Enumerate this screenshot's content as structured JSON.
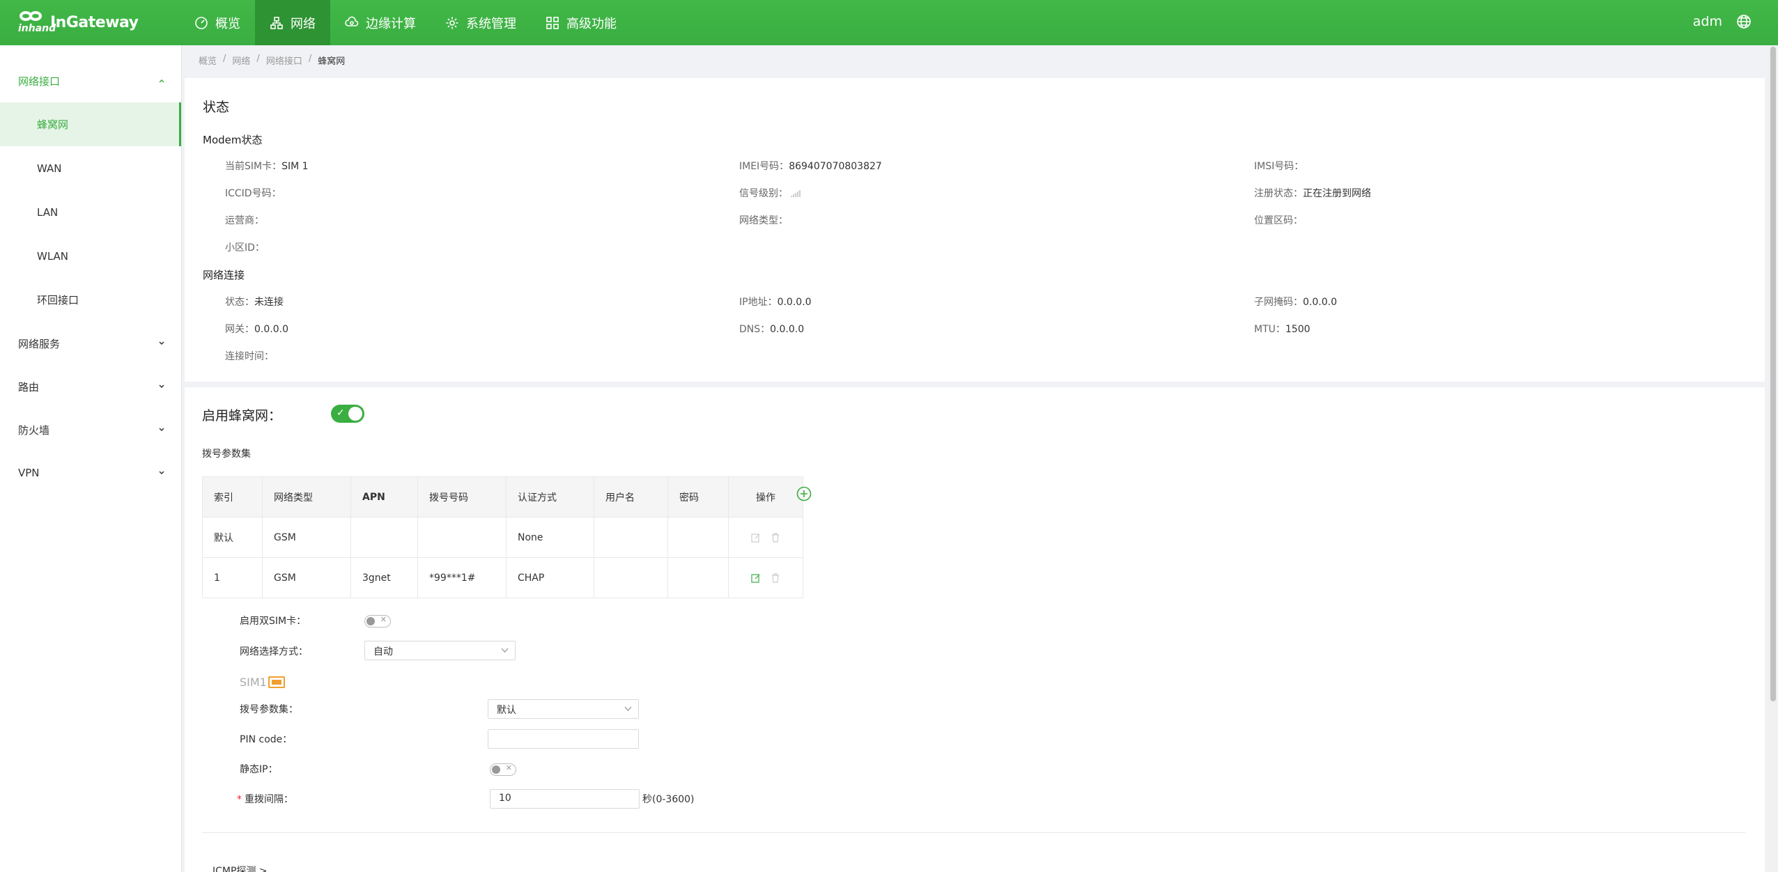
{
  "app": {
    "logo_text": "InGateway",
    "logo_sub": "inhand"
  },
  "topnav": {
    "items": [
      {
        "label": "概览"
      },
      {
        "label": "网络"
      },
      {
        "label": "边缘计算"
      },
      {
        "label": "系统管理"
      },
      {
        "label": "高级功能"
      }
    ],
    "active_index": 1,
    "user": "adm"
  },
  "sidebar": {
    "groups": [
      {
        "label": "网络接口",
        "open": true,
        "items": [
          "蜂窝网",
          "WAN",
          "LAN",
          "WLAN",
          "环回接口"
        ],
        "active": "蜂窝网"
      },
      {
        "label": "网络服务",
        "open": false
      },
      {
        "label": "路由",
        "open": false
      },
      {
        "label": "防火墙",
        "open": false
      },
      {
        "label": "VPN",
        "open": false
      }
    ]
  },
  "breadcrumb": [
    "概览",
    "网络",
    "网络接口",
    "蜂窝网"
  ],
  "status": {
    "title": "状态",
    "modem_label": "Modem状态",
    "modem": {
      "sim_label": "当前SIM卡：",
      "sim_value": "SIM 1",
      "imei_label": "IMEI号码：",
      "imei_value": "869407070803827",
      "imsi_label": "IMSI号码：",
      "imsi_value": "",
      "iccid_label": "ICCID号码：",
      "iccid_value": "",
      "signal_label": "信号级别：",
      "reg_label": "注册状态：",
      "reg_value": "正在注册到网络",
      "operator_label": "运营商：",
      "operator_value": "",
      "nettype_label": "网络类型：",
      "nettype_value": "",
      "lac_label": "位置区码：",
      "lac_value": "",
      "cell_label": "小区ID：",
      "cell_value": ""
    },
    "conn_label": "网络连接",
    "conn": {
      "state_label": "状态：",
      "state_value": "未连接",
      "ip_label": "IP地址：",
      "ip_value": "0.0.0.0",
      "mask_label": "子网掩码：",
      "mask_value": "0.0.0.0",
      "gw_label": "网关：",
      "gw_value": "0.0.0.0",
      "dns_label": "DNS：",
      "dns_value": "0.0.0.0",
      "mtu_label": "MTU：",
      "mtu_value": "1500",
      "time_label": "连接时间：",
      "time_value": ""
    }
  },
  "config": {
    "enable_label": "启用蜂窝网：",
    "enable_on": true,
    "dial_set_label": "拨号参数集",
    "table": {
      "headers": [
        "索引",
        "网络类型",
        "APN",
        "拨号号码",
        "认证方式",
        "用户名",
        "密码",
        "操作"
      ],
      "rows": [
        [
          "默认",
          "GSM",
          "",
          "",
          "None",
          "",
          ""
        ],
        [
          "1",
          "GSM",
          "3gnet",
          "*99***1#",
          "CHAP",
          "",
          ""
        ]
      ]
    },
    "dual_sim_label": "启用双SIM卡：",
    "dual_sim_on": false,
    "net_select_label": "网络选择方式：",
    "net_select_value": "自动",
    "sim1_label": "SIM1",
    "dial_param_label": "拨号参数集：",
    "dial_param_value": "默认",
    "pin_label": "PIN code：",
    "pin_value": "",
    "static_ip_label": "静态IP：",
    "static_ip_on": false,
    "redial_label": "重拨间隔：",
    "redial_value": "10",
    "redial_suffix": "秒(0-3600)",
    "icmp_label": "ICMP探测"
  },
  "colors": {
    "brand": "#3aae41",
    "nav_active": "#2e9333"
  }
}
